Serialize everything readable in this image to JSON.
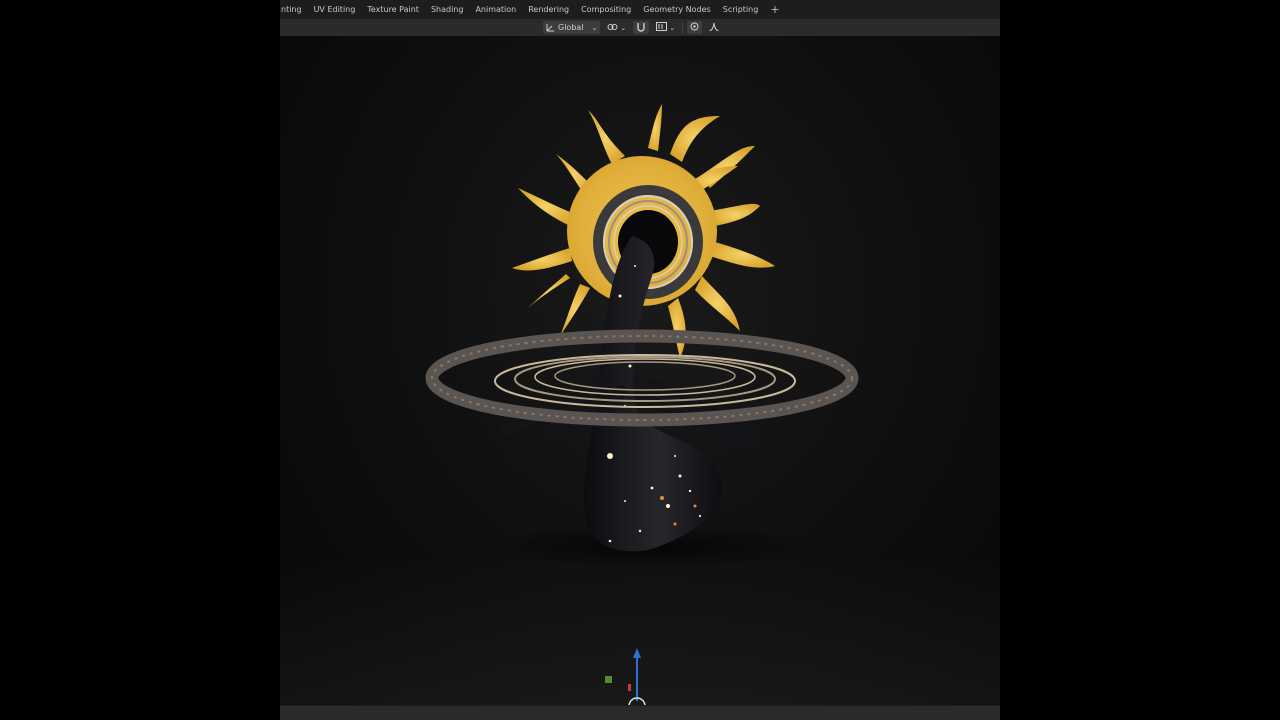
{
  "workspace_tabs": [
    "nting",
    "UV Editing",
    "Texture Paint",
    "Shading",
    "Animation",
    "Rendering",
    "Compositing",
    "Geometry Nodes",
    "Scripting"
  ],
  "add_tab_label": "+",
  "header": {
    "orientation_label": "Global",
    "transform_icon": "transform-orientation-icon",
    "pivot_icon": "pivot-link-icon",
    "snap_icon": "snap-magnet-icon",
    "snap_increment_icon": "snap-increment-icon",
    "proportional_icon": "proportional-editing-icon",
    "falloff_icon": "falloff-curve-icon"
  },
  "viewport": {
    "subject": "3d-sculpture",
    "background_color": "#0b0b0b",
    "sun_color": "#e8b83a",
    "ring_color": "#5a5551",
    "body_color": "#141418"
  },
  "gizmo": {
    "z_axis_color": "#2f6fd8",
    "x_axis_color": "#c53a3a",
    "y_axis_color": "#5a8a2a"
  }
}
